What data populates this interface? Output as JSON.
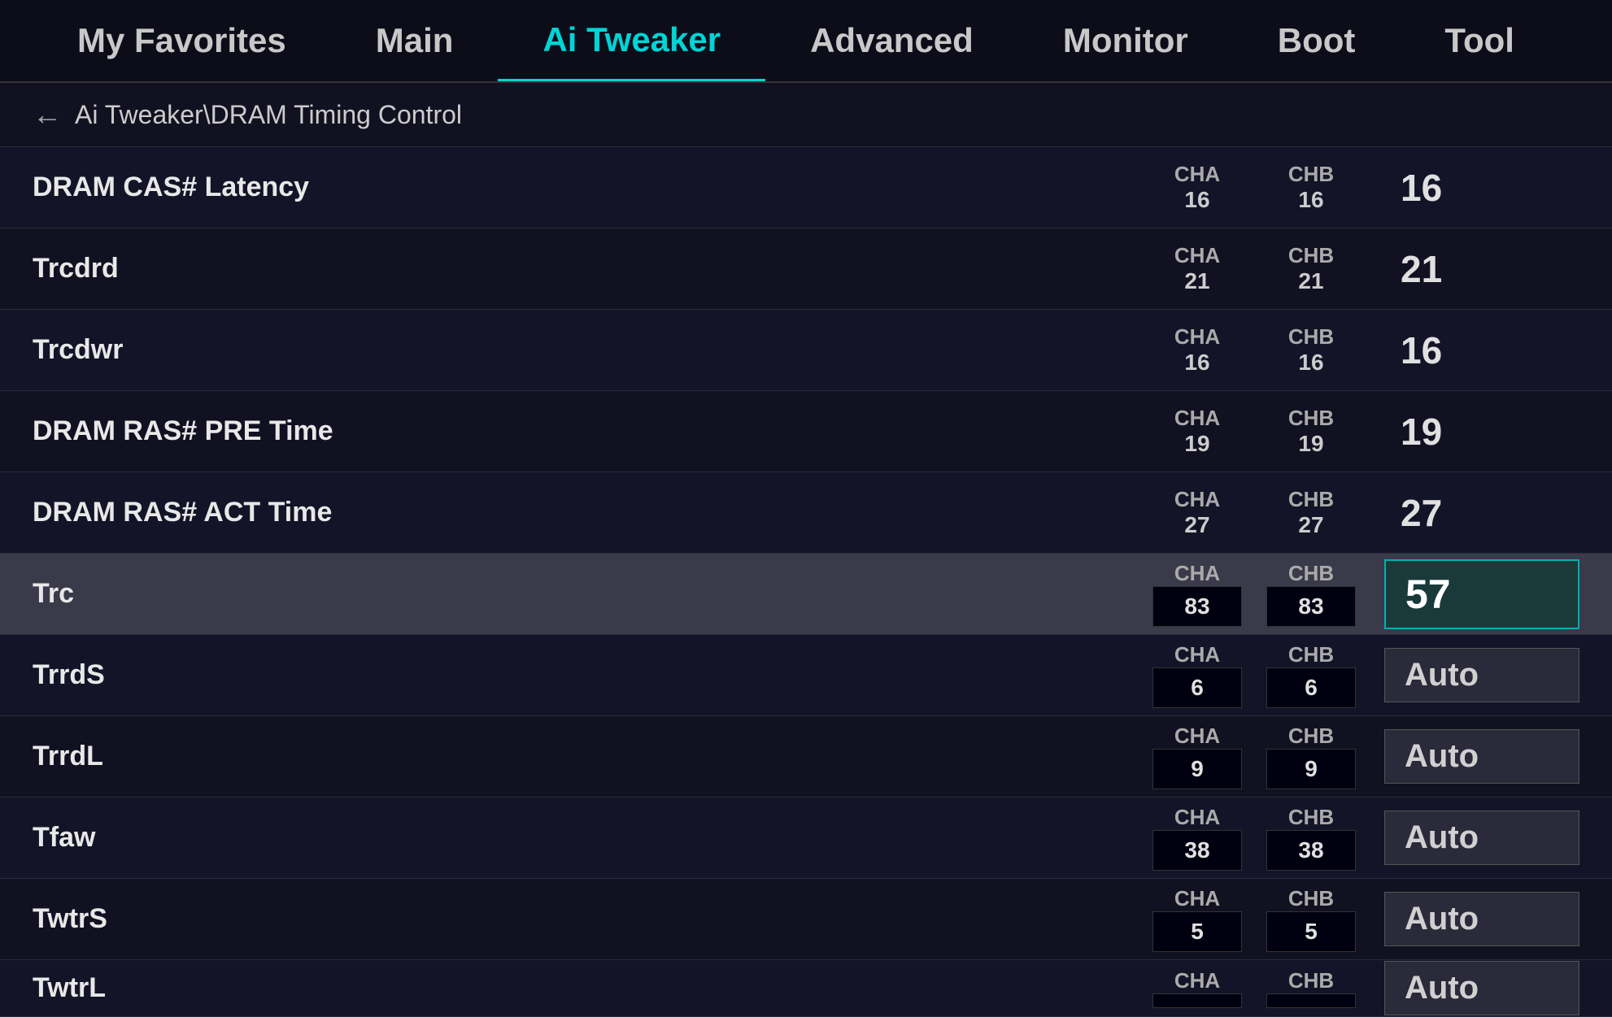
{
  "nav": {
    "items": [
      {
        "label": "My Favorites",
        "active": false
      },
      {
        "label": "Main",
        "active": false
      },
      {
        "label": "Ai Tweaker",
        "active": true
      },
      {
        "label": "Advanced",
        "active": false
      },
      {
        "label": "Monitor",
        "active": false
      },
      {
        "label": "Boot",
        "active": false
      },
      {
        "label": "Tool",
        "active": false
      }
    ]
  },
  "breadcrumb": {
    "arrow": "←",
    "text": "Ai Tweaker\\DRAM Timing Control"
  },
  "rows": [
    {
      "label": "DRAM CAS# Latency",
      "cha_label": "CHA",
      "cha_value": "16",
      "chb_label": "CHB",
      "chb_value": "16",
      "value": "16",
      "style": "number",
      "selected": false,
      "box_channels": false
    },
    {
      "label": "Trcdrd",
      "cha_label": "CHA",
      "cha_value": "21",
      "chb_label": "CHB",
      "chb_value": "21",
      "value": "21",
      "style": "number",
      "selected": false,
      "box_channels": false
    },
    {
      "label": "Trcdwr",
      "cha_label": "CHA",
      "cha_value": "16",
      "chb_label": "CHB",
      "chb_value": "16",
      "value": "16",
      "style": "number",
      "selected": false,
      "box_channels": false
    },
    {
      "label": "DRAM RAS# PRE Time",
      "cha_label": "CHA",
      "cha_value": "19",
      "chb_label": "CHB",
      "chb_value": "19",
      "value": "19",
      "style": "number",
      "selected": false,
      "box_channels": false
    },
    {
      "label": "DRAM RAS# ACT Time",
      "cha_label": "CHA",
      "cha_value": "27",
      "chb_label": "CHB",
      "chb_value": "27",
      "value": "27",
      "style": "number",
      "selected": false,
      "box_channels": false
    },
    {
      "label": "Trc",
      "cha_label": "CHA",
      "cha_value": "83",
      "chb_label": "CHB",
      "chb_value": "83",
      "value": "57",
      "style": "highlighted",
      "selected": true,
      "box_channels": true
    },
    {
      "label": "TrrdS",
      "cha_label": "CHA",
      "cha_value": "6",
      "chb_label": "CHB",
      "chb_value": "6",
      "value": "Auto",
      "style": "auto",
      "selected": false,
      "box_channels": true
    },
    {
      "label": "TrrdL",
      "cha_label": "CHA",
      "cha_value": "9",
      "chb_label": "CHB",
      "chb_value": "9",
      "value": "Auto",
      "style": "auto",
      "selected": false,
      "box_channels": true
    },
    {
      "label": "Tfaw",
      "cha_label": "CHA",
      "cha_value": "38",
      "chb_label": "CHB",
      "chb_value": "38",
      "value": "Auto",
      "style": "auto",
      "selected": false,
      "box_channels": true
    },
    {
      "label": "TwtrS",
      "cha_label": "CHA",
      "cha_value": "5",
      "chb_label": "CHB",
      "chb_value": "5",
      "value": "Auto",
      "style": "auto",
      "selected": false,
      "box_channels": true
    },
    {
      "label": "TwtrL",
      "cha_label": "CHA",
      "cha_value": "",
      "chb_label": "CHB",
      "chb_value": "",
      "value": "Auto",
      "style": "auto",
      "selected": false,
      "box_channels": true,
      "partial": true
    }
  ]
}
